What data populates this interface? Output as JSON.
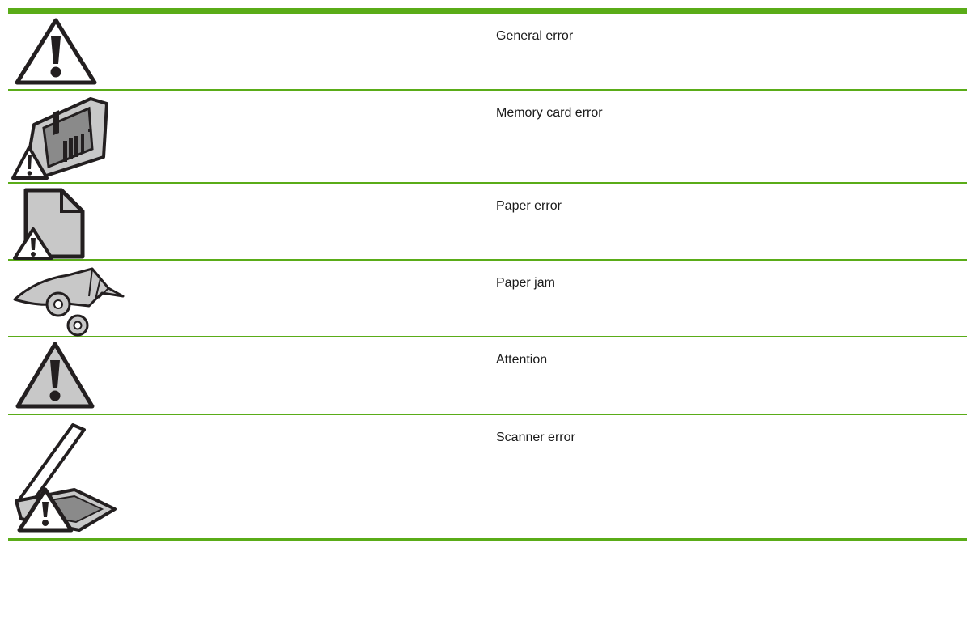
{
  "colors": {
    "rule": "#5aac18",
    "icon_gray": "#c8c8c8",
    "icon_dark": "#231f20"
  },
  "rows": [
    {
      "icon": "general-error-icon",
      "label": "General error"
    },
    {
      "icon": "memory-card-error-icon",
      "label": "Memory card error"
    },
    {
      "icon": "paper-error-icon",
      "label": "Paper error"
    },
    {
      "icon": "paper-jam-icon",
      "label": "Paper jam"
    },
    {
      "icon": "attention-icon",
      "label": "Attention"
    },
    {
      "icon": "scanner-error-icon",
      "label": "Scanner error"
    }
  ]
}
